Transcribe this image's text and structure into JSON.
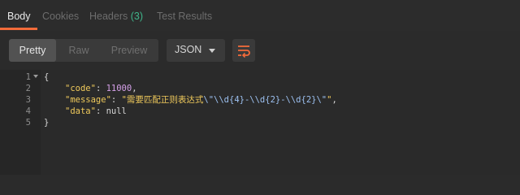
{
  "tabs": {
    "body": "Body",
    "cookies": "Cookies",
    "headers": "Headers",
    "headers_count": "(3)",
    "test_results": "Test Results"
  },
  "toolbar": {
    "pretty": "Pretty",
    "raw": "Raw",
    "preview": "Preview",
    "format": "JSON",
    "wrap_icon": "wrap-lines-icon"
  },
  "editor": {
    "line_numbers": [
      "1",
      "2",
      "3",
      "4",
      "5"
    ],
    "lines": {
      "l1": "{",
      "code_key": "\"code\"",
      "code_colon": ": ",
      "code_value": "11000",
      "code_comma": ",",
      "message_key": "\"message\"",
      "message_colon": ": ",
      "message_text": "\"需要匹配正则表达式",
      "message_escape": "\\\"\\\\d{4}-\\\\d{2}-\\\\d{2}\\\"",
      "message_close": "\"",
      "message_comma": ",",
      "data_key": "\"data\"",
      "data_colon": ": ",
      "data_value": "null",
      "l5": "}"
    }
  },
  "colors": {
    "accent": "#f26b3a",
    "count": "#3fb58a",
    "string": "#efc95b",
    "number": "#d5a0e8"
  }
}
